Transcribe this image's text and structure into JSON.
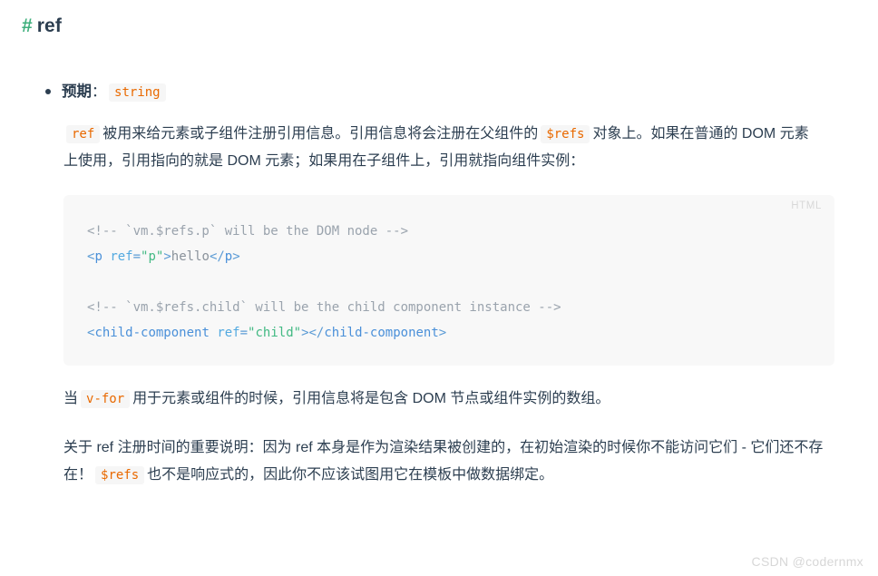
{
  "heading": {
    "anchor": "#",
    "text": "ref",
    "anchor_color": "#3eaf7c",
    "text_color": "#2c3e50"
  },
  "bullet": {
    "label": "预期",
    "colon": "：",
    "code": "string"
  },
  "paragraph1": {
    "code_ref": "ref",
    "part1": "被用来给元素或子组件注册引用信息。引用信息将会注册在父组件的",
    "code_refs": "$refs",
    "part2": "对象上。如果在普通的 DOM 元素上使用，引用指向的就是 DOM 元素；如果用在子组件上，引用就指向组件实例："
  },
  "codeblock": {
    "lang_label": "HTML",
    "lines": [
      {
        "tokens": [
          {
            "t": "comment",
            "v": "<!-- `vm.$refs.p` will be the DOM node -->"
          }
        ]
      },
      {
        "tokens": [
          {
            "t": "punct",
            "v": "<"
          },
          {
            "t": "tag",
            "v": "p"
          },
          {
            "t": "text",
            "v": " "
          },
          {
            "t": "attr",
            "v": "ref"
          },
          {
            "t": "punct",
            "v": "="
          },
          {
            "t": "string",
            "v": "\"p\""
          },
          {
            "t": "punct",
            "v": ">"
          },
          {
            "t": "text",
            "v": "hello"
          },
          {
            "t": "punct",
            "v": "</"
          },
          {
            "t": "tag",
            "v": "p"
          },
          {
            "t": "punct",
            "v": ">"
          }
        ]
      },
      {
        "tokens": []
      },
      {
        "tokens": [
          {
            "t": "comment",
            "v": "<!-- `vm.$refs.child` will be the child component instance -->"
          }
        ]
      },
      {
        "tokens": [
          {
            "t": "punct",
            "v": "<"
          },
          {
            "t": "tag",
            "v": "child-component"
          },
          {
            "t": "text",
            "v": " "
          },
          {
            "t": "attr",
            "v": "ref"
          },
          {
            "t": "punct",
            "v": "="
          },
          {
            "t": "string",
            "v": "\"child\""
          },
          {
            "t": "punct",
            "v": ">"
          },
          {
            "t": "punct",
            "v": "</"
          },
          {
            "t": "tag",
            "v": "child-component"
          },
          {
            "t": "punct",
            "v": ">"
          }
        ]
      }
    ]
  },
  "paragraph2": {
    "part1": "当",
    "code_vfor": "v-for",
    "part2": "用于元素或组件的时候，引用信息将是包含 DOM 节点或组件实例的数组。"
  },
  "paragraph3": {
    "part1": "关于 ref 注册时间的重要说明：因为 ref 本身是作为渲染结果被创建的，在初始渲染的时候你不能访问它们 - 它们还不存在！",
    "code_refs": "$refs",
    "part2": "也不是响应式的，因此你不应该试图用它在模板中做数据绑定。"
  },
  "watermark": {
    "text": "CSDN @codernmx"
  },
  "colors": {
    "accent_green": "#3eaf7c",
    "text": "#2c3e50",
    "inline_code": "#e96900",
    "inline_code_bg": "#f6f6f6",
    "code_bg": "#f8f8f8",
    "comment": "#9aa3ad",
    "tag": "#4a90d9",
    "string": "#42b983",
    "watermark": "#d7d7d7"
  }
}
